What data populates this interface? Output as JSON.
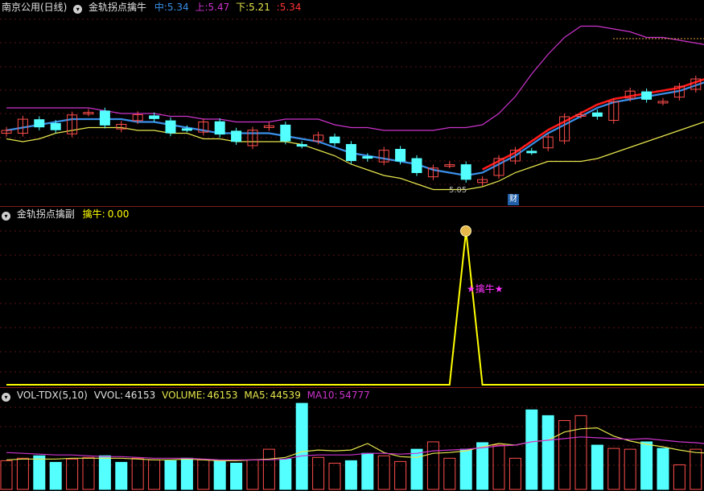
{
  "main_panel": {
    "stock_name": "南京公用(日线)",
    "indicator": "金轨拐点擒牛",
    "mid_label": "中:",
    "mid_value": "5.34",
    "up_label": "上:",
    "up_value": "5.47",
    "down_label": "下:",
    "down_value": "5.21",
    "extra_label": ":",
    "extra_value": "5.34",
    "low_price_label": "5.05",
    "finance_badge": "财",
    "colors": {
      "mid": "#3a8fe8",
      "upper": "#cc33cc",
      "lower": "#e6e64d",
      "rising": "#ff4d4d",
      "falling": "#54ffff",
      "ma_red": "#ff1a1a"
    }
  },
  "sub_panel": {
    "indicator": "金轨拐点擒副",
    "signal_label": "擒牛:",
    "signal_value": "0.00",
    "star_label": "★擒牛★",
    "colors": {
      "signal": "#ffff00",
      "star": "#ff33ff"
    }
  },
  "vol_panel": {
    "indicator": "VOL-TDX(5,10)",
    "vvol_label": "VVOL:",
    "vvol_value": "46153",
    "volume_label": "VOLUME:",
    "volume_value": "46153",
    "ma5_label": "MA5:",
    "ma5_value": "44539",
    "ma10_label": "MA10:",
    "ma10_value": "54777",
    "colors": {
      "ma5": "#e6e64d",
      "ma10": "#cc33cc"
    }
  },
  "chart_data": [
    {
      "type": "candlestick",
      "title": "南京公用(日线)",
      "series": [
        {
          "name": "中",
          "values": [
            5.1,
            5.11,
            5.12,
            5.13,
            5.14,
            5.14,
            5.14,
            5.14,
            5.13,
            5.13,
            5.12,
            5.11,
            5.1,
            5.09,
            5.09,
            5.09,
            5.09,
            5.08,
            5.07,
            5.06,
            5.04,
            5.02,
            5.01,
            5.0,
            4.99,
            4.98,
            4.96,
            4.95,
            4.94,
            4.95,
            4.98,
            5.01,
            5.05,
            5.09,
            5.12,
            5.15,
            5.18,
            5.2,
            5.21,
            5.22,
            5.23,
            5.24,
            5.26,
            5.28
          ]
        },
        {
          "name": "上",
          "values": [
            5.18,
            5.18,
            5.18,
            5.18,
            5.18,
            5.18,
            5.17,
            5.16,
            5.16,
            5.16,
            5.15,
            5.15,
            5.14,
            5.14,
            5.13,
            5.13,
            5.13,
            5.14,
            5.14,
            5.14,
            5.12,
            5.11,
            5.11,
            5.1,
            5.1,
            5.1,
            5.1,
            5.11,
            5.11,
            5.12,
            5.16,
            5.22,
            5.3,
            5.37,
            5.43,
            5.47,
            5.47,
            5.46,
            5.45,
            5.43,
            5.43,
            5.42,
            5.41,
            5.4
          ]
        },
        {
          "name": "下",
          "values": [
            5.07,
            5.06,
            5.07,
            5.09,
            5.1,
            5.11,
            5.11,
            5.11,
            5.1,
            5.1,
            5.09,
            5.09,
            5.07,
            5.07,
            5.06,
            5.06,
            5.06,
            5.06,
            5.05,
            5.03,
            5.01,
            4.98,
            4.96,
            4.94,
            4.93,
            4.91,
            4.89,
            4.89,
            4.89,
            4.9,
            4.92,
            4.95,
            4.97,
            4.99,
            4.99,
            4.99,
            5.0,
            5.02,
            5.04,
            5.06,
            5.08,
            5.1,
            5.12,
            5.14
          ]
        }
      ]
    },
    {
      "type": "line",
      "title": "金轨拐点擒副",
      "series": [
        {
          "name": "擒牛",
          "values": [
            0,
            0,
            0,
            0,
            0,
            0,
            0,
            0,
            0,
            0,
            0,
            0,
            0,
            0,
            0,
            0,
            0,
            0,
            0,
            0,
            0,
            0,
            0,
            0,
            0,
            0,
            0,
            0,
            1,
            0,
            0,
            0,
            0,
            0,
            0,
            0,
            0,
            0,
            0,
            0,
            0,
            0,
            0,
            0
          ]
        }
      ]
    },
    {
      "type": "bar",
      "title": "VOL-TDX(5,10)",
      "series": [
        {
          "name": "VOLUME",
          "values": [
            35,
            38,
            41,
            33,
            37,
            39,
            41,
            33,
            38,
            36,
            35,
            38,
            36,
            35,
            32,
            36,
            49,
            37,
            105,
            39,
            32,
            35,
            44,
            41,
            34,
            49,
            58,
            38,
            49,
            57,
            54,
            38,
            97,
            90,
            84,
            90,
            54,
            50,
            49,
            58,
            50,
            30,
            49,
            50
          ]
        },
        {
          "name": "MA5",
          "values": [
            36,
            37,
            37,
            37,
            38,
            38,
            38,
            38,
            37,
            36,
            36,
            37,
            36,
            35,
            35,
            36,
            37,
            39,
            46,
            48,
            47,
            48,
            56,
            45,
            40,
            39,
            44,
            45,
            47,
            52,
            56,
            54,
            58,
            60,
            70,
            74,
            75,
            65,
            59,
            55,
            52,
            48,
            45,
            44
          ]
        },
        {
          "name": "MA10",
          "values": [
            45,
            44,
            43,
            42,
            42,
            41,
            40,
            40,
            39,
            38,
            38,
            38,
            37,
            36,
            36,
            36,
            36,
            37,
            41,
            42,
            42,
            42,
            44,
            44,
            43,
            44,
            47,
            48,
            49,
            51,
            53,
            54,
            58,
            60,
            62,
            64,
            63,
            62,
            61,
            62,
            60,
            58,
            57,
            55
          ]
        }
      ]
    }
  ]
}
